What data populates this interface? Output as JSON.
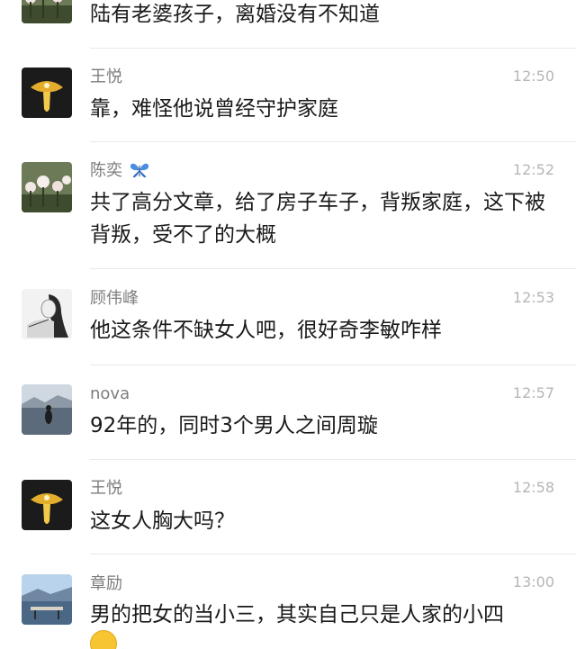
{
  "comments": [
    {
      "name": "",
      "time": "",
      "text": "陆有老婆孩子，离婚没有不知道",
      "avatar": "avatar-flowers"
    },
    {
      "name": "王悦",
      "time": "12:50",
      "text": "靠，难怪他说曾经守护家庭",
      "avatar": "avatar-lamp"
    },
    {
      "name": "陈奕",
      "name_emoji": "butterfly",
      "time": "12:52",
      "text": "共了高分文章，给了房子车子，背叛家庭，这下被背叛，受不了的大概",
      "avatar": "avatar-flowers"
    },
    {
      "name": "顾伟峰",
      "time": "12:53",
      "text": "他这条件不缺女人吧，很好奇李敏咋样",
      "avatar": "avatar-girl-sketch"
    },
    {
      "name": "nova",
      "time": "12:57",
      "text": "92年的，同时3个男人之间周璇",
      "avatar": "avatar-sea"
    },
    {
      "name": "王悦",
      "time": "12:58",
      "text": "这女人胸大吗？",
      "avatar": "avatar-lamp"
    },
    {
      "name": "章励",
      "time": "13:00",
      "text": "男的把女的当小三，其实自己只是人家的小四",
      "avatar": "avatar-pier"
    }
  ],
  "colors": {
    "name": "#7d7d7d",
    "time": "#b6b6b6",
    "text": "#1a1a1a",
    "divider": "#e8e8e8"
  }
}
